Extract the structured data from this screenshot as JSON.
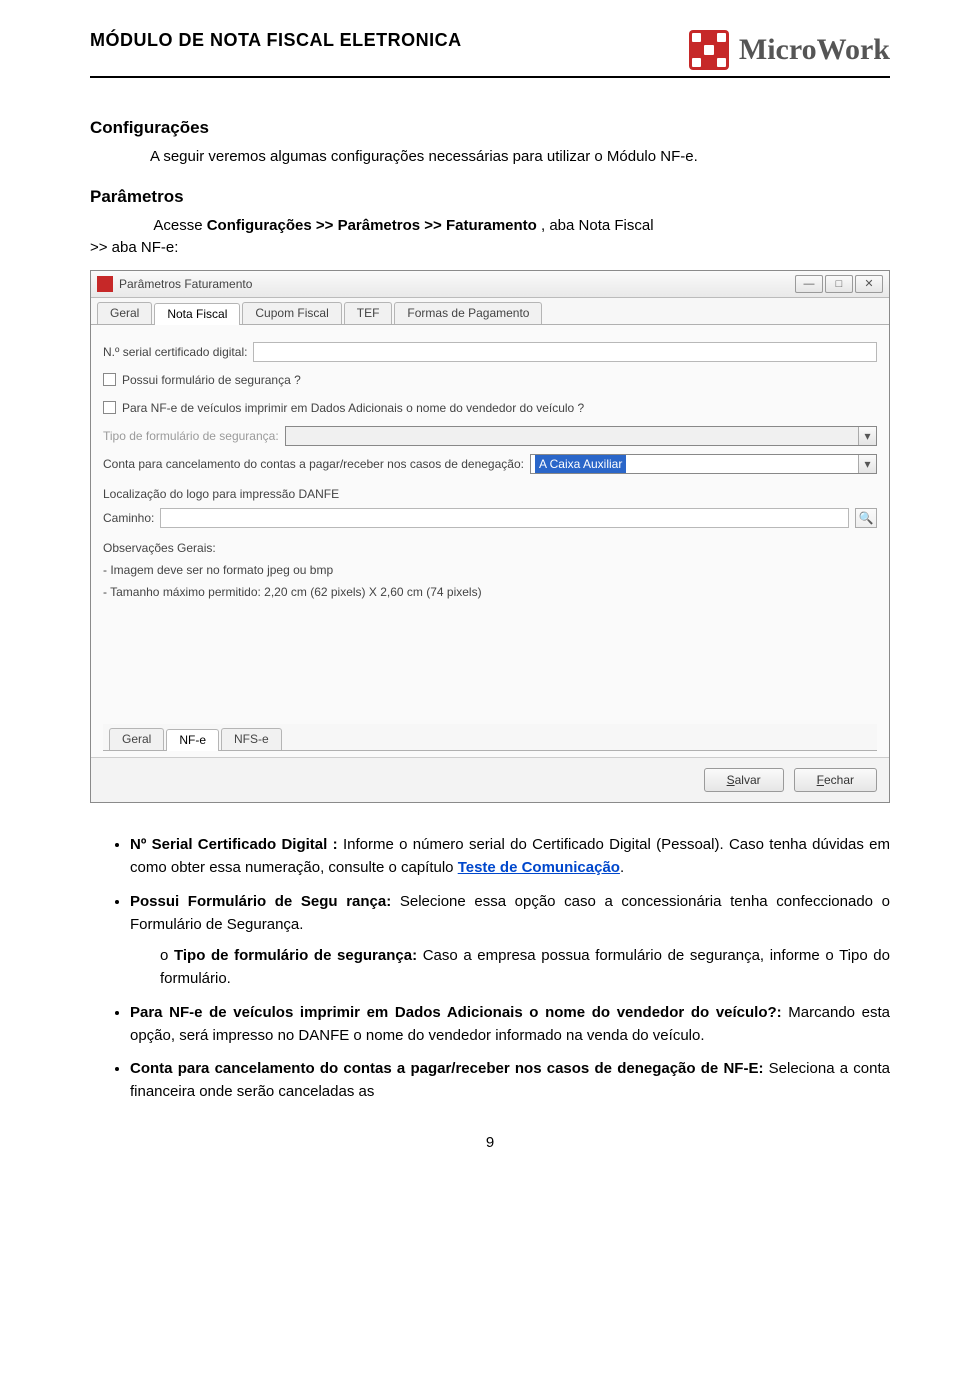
{
  "header": {
    "doc_title": "MÓDULO DE  NOTA FISCAL ELETRONICA",
    "brand": "MicroWork"
  },
  "sections": {
    "config_h": "Configurações",
    "config_p": "A seguir veremos algumas configurações necessárias para utilizar o Módulo NF-e.",
    "param_h": "Parâmetros",
    "param_prefix": ">> aba NF-e:",
    "param_line_a": "Acesse ",
    "param_line_b": "Configurações >>  Parâmetros >> Faturamento",
    "param_line_c": " , aba Nota Fiscal "
  },
  "window": {
    "title": "Parâmetros Faturamento",
    "top_tabs": [
      "Geral",
      "Nota Fiscal",
      "Cupom Fiscal",
      "TEF",
      "Formas de Pagamento"
    ],
    "active_top_tab": 1,
    "labels": {
      "serial": "N.º serial certificado digital:",
      "chk_form": "Possui formulário de segurança ?",
      "chk_nfe_veic": "Para NF-e de veículos imprimir em Dados Adicionais o nome do vendedor do veículo ?",
      "tipo_form": "Tipo de formulário de segurança:",
      "conta_canc": "Conta para cancelamento do contas a pagar/receber nos casos de denegação:",
      "loc_logo": "Localização do logo para impressão DANFE",
      "caminho": "Caminho:",
      "obs_h": "Observações Gerais:",
      "obs1": "- Imagem deve ser no formato jpeg ou bmp",
      "obs2": "- Tamanho máximo permitido: 2,20 cm (62 pixels) X 2,60 cm (74 pixels)"
    },
    "combo_conta_value": "A Caixa Auxiliar",
    "bottom_tabs": [
      "Geral",
      "NF-e",
      "NFS-e"
    ],
    "active_bottom_tab": 1,
    "buttons": {
      "save": "Salvar",
      "close": "Fechar"
    },
    "win_controls": {
      "min": "—",
      "max": "□",
      "close": "✕"
    }
  },
  "bullets": {
    "b1_a": "Nº Serial Certificado Digital : ",
    "b1_b": "Informe o número serial do Certificado Digital (Pessoal). Caso tenha dúvidas em como obter essa numeração, consulte o capítulo ",
    "b1_link": "Teste de Comunicação",
    "b1_c": ".",
    "b2_a": "Possui Formulário de Segu rança:",
    "b2_b": "    Selecione    essa    opção    caso    a concessionária tenha confeccionado o Formulário de Segurança.",
    "b2_sub_a": "Tipo de formulário de segurança: ",
    "b2_sub_b": "Caso a empresa possua formulário de segurança, informe o Tipo do formulário.",
    "b3_a": "Para NF-e de veículos imprimir em Dados Adicionais o nome do vendedor do veículo?: ",
    "b3_b": "Marcando esta opção, será impresso no DANFE o nome do vendedor informado na venda do veículo.",
    "b4_a": "Conta para cancelamento do contas a pagar/receber nos casos de denegação de NF-E: ",
    "b4_b": "Seleciona a conta financeira onde serão canceladas as"
  },
  "page_number": "9"
}
